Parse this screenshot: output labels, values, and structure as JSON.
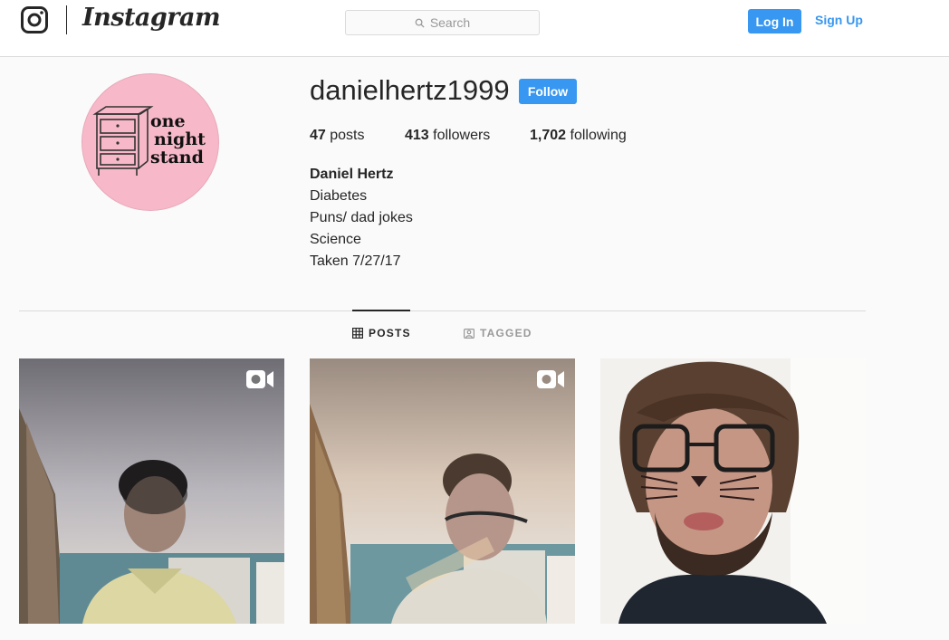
{
  "nav": {
    "wordmark": "Instagram",
    "search_placeholder": "Search",
    "login_label": "Log In",
    "signup_label": "Sign Up"
  },
  "profile": {
    "avatar_text": [
      "one",
      "night",
      "stand"
    ],
    "username": "danielhertz1999",
    "follow_label": "Follow",
    "stats": {
      "posts_count": "47",
      "posts_label": "posts",
      "followers_count": "413",
      "followers_label": "followers",
      "following_count": "1,702",
      "following_label": "following"
    },
    "bio": {
      "full_name": "Daniel Hertz",
      "lines": [
        "Diabetes",
        "Puns/ dad jokes",
        "Science",
        "Taken 7/27/17"
      ]
    }
  },
  "tabs": [
    {
      "label": "POSTS",
      "icon": "grid-icon",
      "active": true
    },
    {
      "label": "TAGGED",
      "icon": "tag-icon",
      "active": false
    }
  ],
  "posts": [
    {
      "type": "video",
      "icon": "video-icon"
    },
    {
      "type": "video",
      "icon": "video-icon"
    },
    {
      "type": "photo"
    }
  ],
  "colors": {
    "accent": "#3897f0",
    "avatar_bg": "#f7b9c9",
    "border": "#dbdbdb",
    "background": "#fafafa"
  }
}
